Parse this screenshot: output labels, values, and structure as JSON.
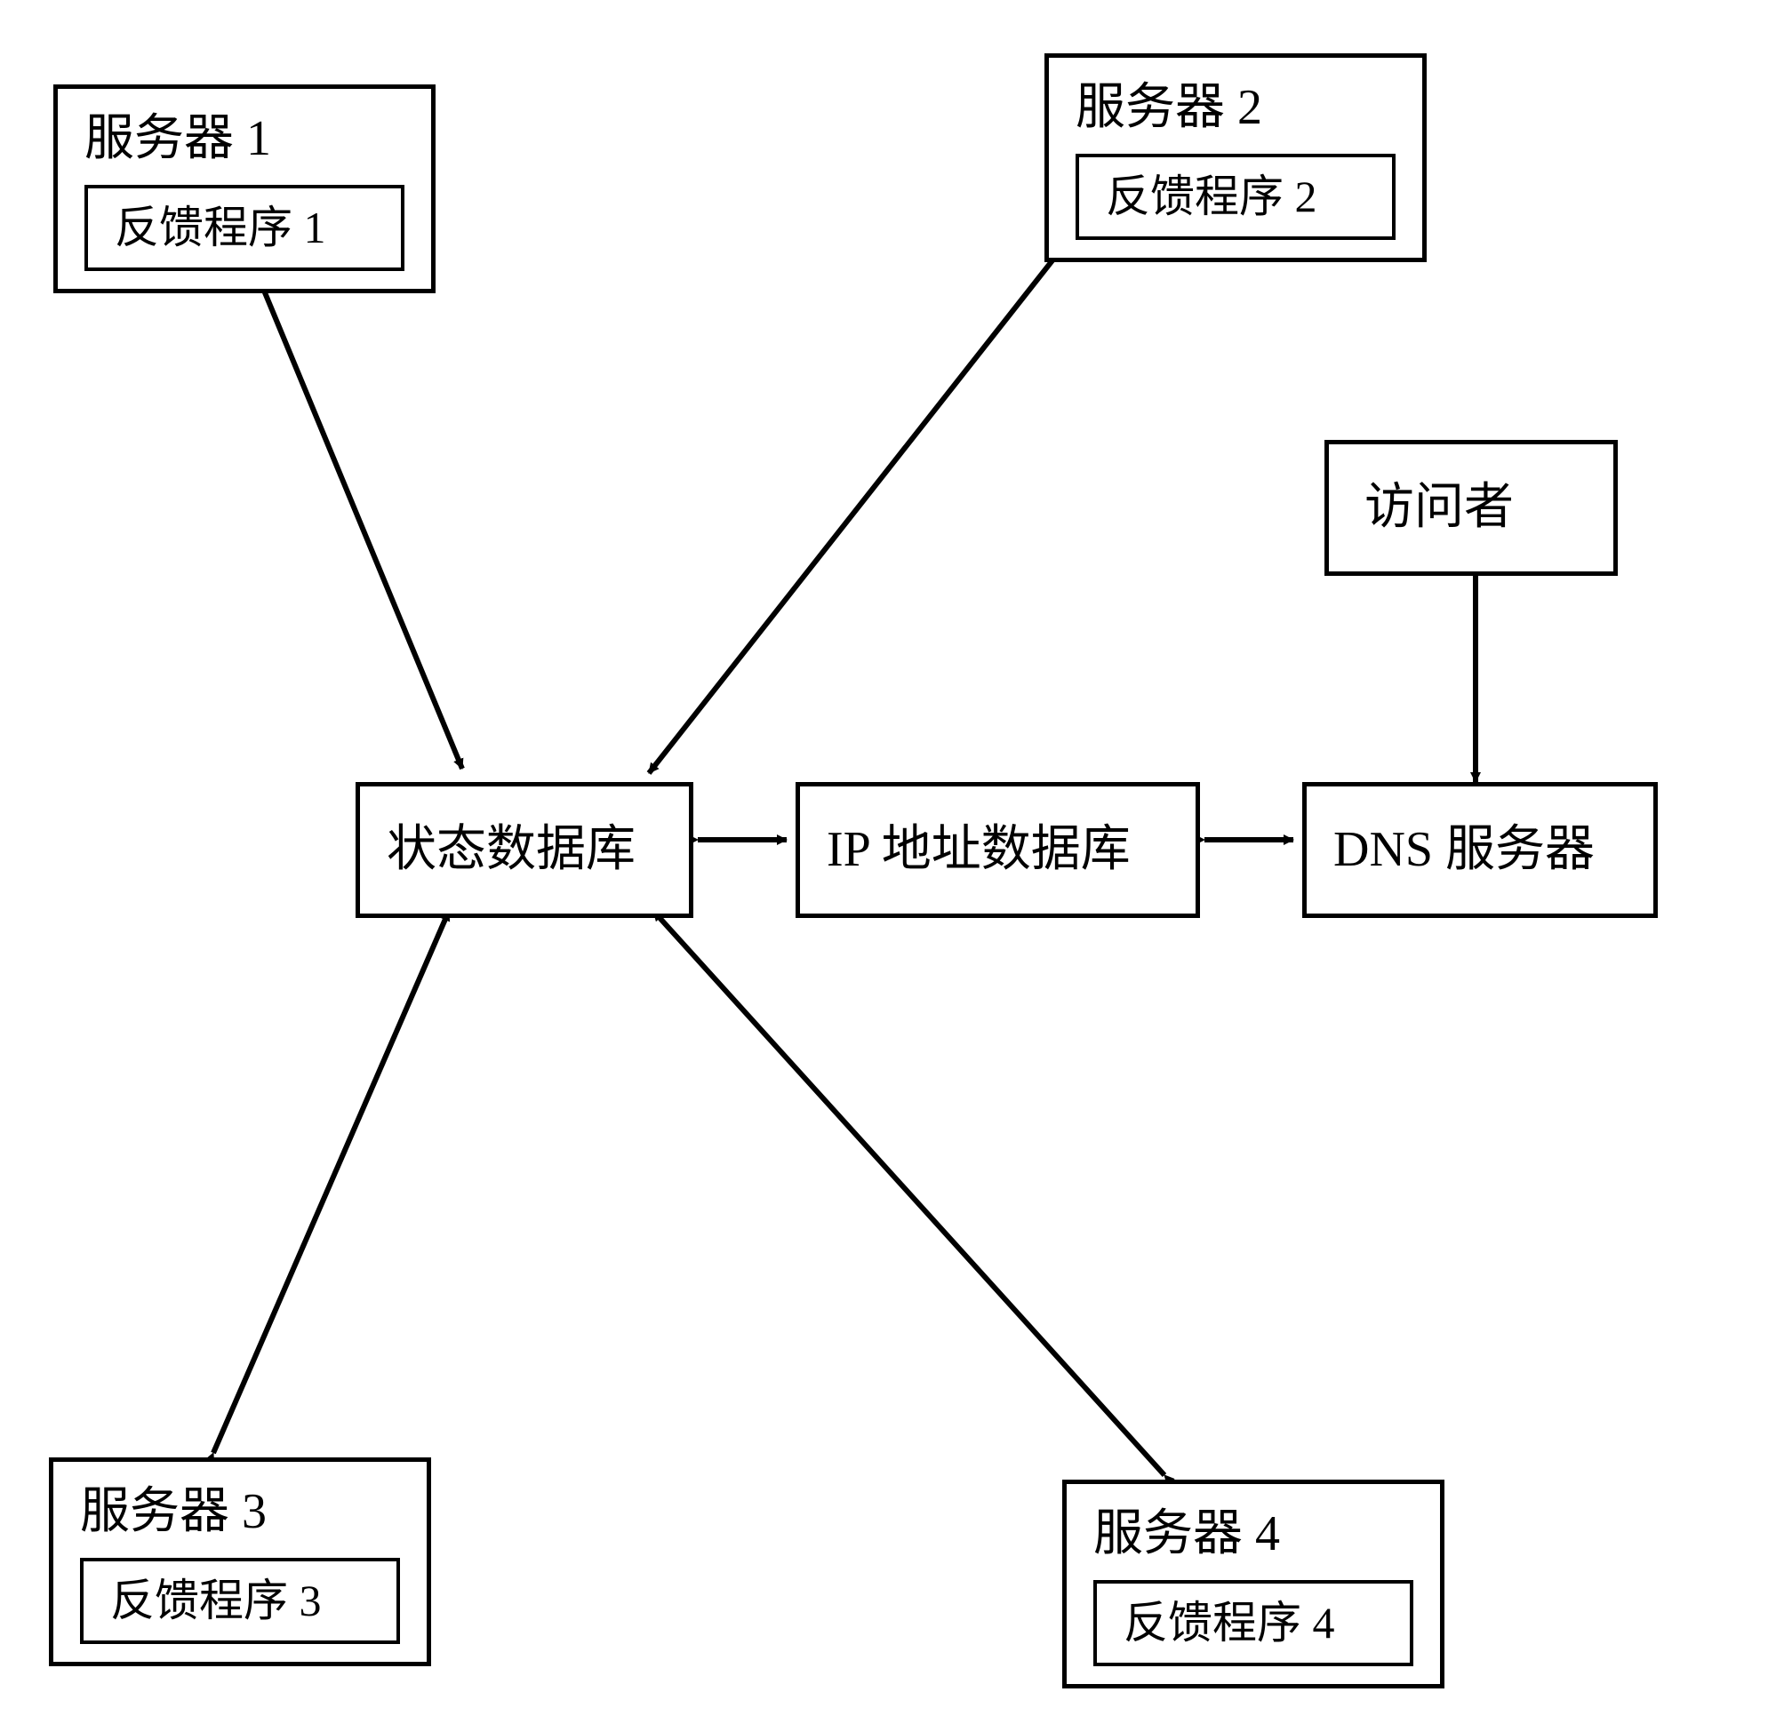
{
  "nodes": {
    "server1": {
      "title": "服务器 1",
      "feedback": "反馈程序 1"
    },
    "server2": {
      "title": "服务器 2",
      "feedback": "反馈程序 2"
    },
    "server3": {
      "title": "服务器 3",
      "feedback": "反馈程序 3"
    },
    "server4": {
      "title": "服务器 4",
      "feedback": "反馈程序 4"
    },
    "statusdb": "状态数据库",
    "ipdb": "IP 地址数据库",
    "dns": "DNS 服务器",
    "visitor": "访问者"
  }
}
